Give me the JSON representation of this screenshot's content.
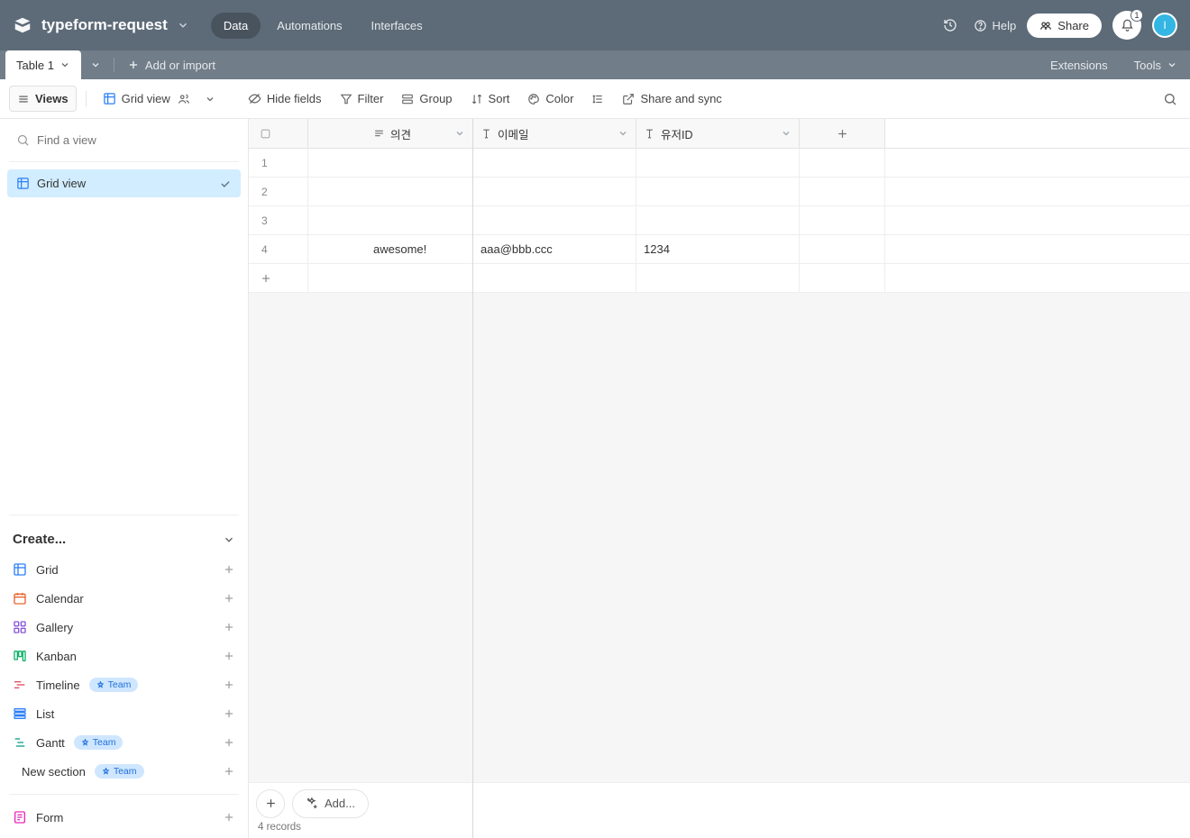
{
  "header": {
    "title": "typeform-request",
    "tabs": {
      "data": "Data",
      "automations": "Automations",
      "interfaces": "Interfaces"
    },
    "help": "Help",
    "share": "Share",
    "notif_count": "1",
    "avatar_initial": "I"
  },
  "tabsbar": {
    "table": "Table 1",
    "add_import": "Add or import",
    "extensions": "Extensions",
    "tools": "Tools"
  },
  "toolbar": {
    "views": "Views",
    "grid_view": "Grid view",
    "hide_fields": "Hide fields",
    "filter": "Filter",
    "group": "Group",
    "sort": "Sort",
    "color": "Color",
    "share_sync": "Share and sync"
  },
  "sidebar": {
    "find_placeholder": "Find a view",
    "grid_view": "Grid view",
    "create": "Create...",
    "items": {
      "grid": "Grid",
      "calendar": "Calendar",
      "gallery": "Gallery",
      "kanban": "Kanban",
      "timeline": "Timeline",
      "list": "List",
      "gantt": "Gantt",
      "new_section": "New section",
      "form": "Form"
    },
    "team": "Team"
  },
  "grid": {
    "columns": {
      "c1": "의견",
      "c2": "이메일",
      "c3": "유저ID"
    },
    "rows": [
      {
        "n": "1",
        "c1": "",
        "c2": "",
        "c3": ""
      },
      {
        "n": "2",
        "c1": "",
        "c2": "",
        "c3": ""
      },
      {
        "n": "3",
        "c1": "",
        "c2": "",
        "c3": ""
      },
      {
        "n": "4",
        "c1": "awesome!",
        "c2": "aaa@bbb.ccc",
        "c3": "1234"
      }
    ],
    "add_menu": "Add...",
    "records": "4 records"
  }
}
